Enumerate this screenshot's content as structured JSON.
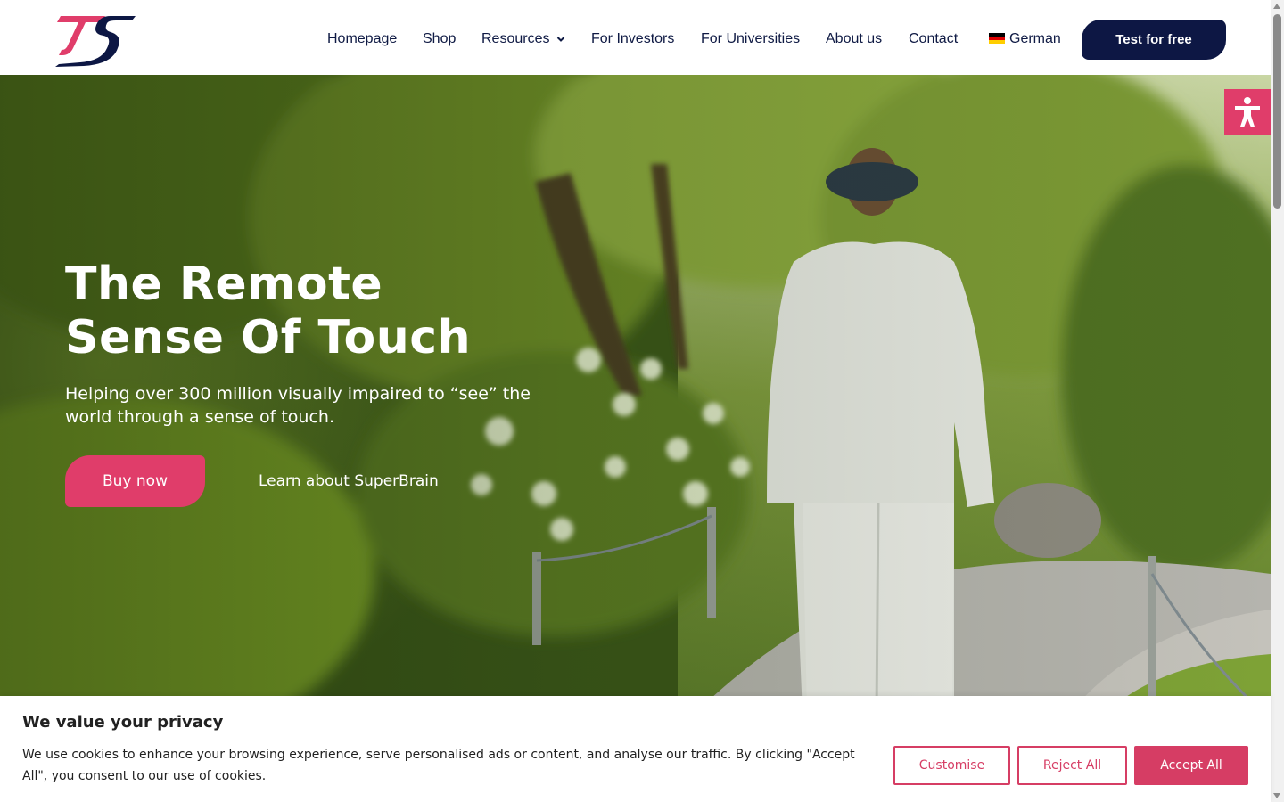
{
  "colors": {
    "brand_navy": "#0d1744",
    "brand_pink": "#e03d6a",
    "cookie_accent": "#d63d64"
  },
  "header": {
    "logo_icon": "brand-logo-icon",
    "nav": {
      "homepage": "Homepage",
      "shop": "Shop",
      "resources": "Resources",
      "investors": "For Investors",
      "universities": "For Universities",
      "about": "About us",
      "contact": "Contact",
      "language": "German"
    },
    "cta": "Test for free"
  },
  "hero": {
    "title_line1": "The Remote",
    "title_line2": "Sense Of Touch",
    "subtitle": "Helping over 300 million visually impaired to “see” the world through a sense of touch.",
    "buy_button": "Buy now",
    "learn_link": "Learn about SuperBrain"
  },
  "accessibility": {
    "icon": "accessibility-icon"
  },
  "cookie_banner": {
    "title": "We value your privacy",
    "text": "We use cookies to enhance your browsing experience, serve personalised ads or content, and analyse our traffic. By clicking \"Accept All\", you consent to our use of cookies.",
    "customise": "Customise",
    "reject": "Reject All",
    "accept": "Accept All"
  }
}
